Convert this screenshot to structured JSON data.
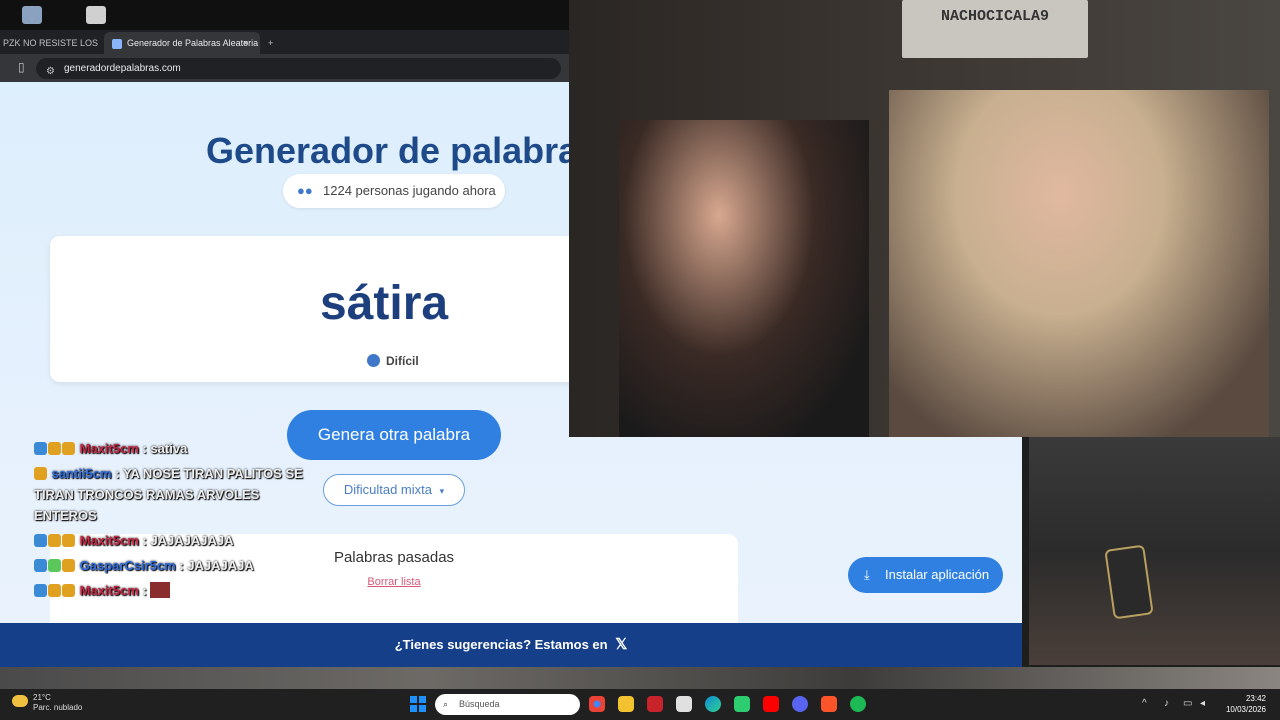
{
  "browser": {
    "tabs": [
      {
        "label": "PZK NO RESISTE LOS Cl",
        "active": false
      },
      {
        "label": "Generador de Palabras Aleatoria",
        "active": true
      }
    ],
    "url": "generadordepalabras.com"
  },
  "page": {
    "title": "Generador de palabras",
    "players": "1224 personas jugando ahora",
    "word": "sátira",
    "difficulty": "Difícil",
    "generate_label": "Genera otra palabra",
    "mode_label": "Dificultad mixta",
    "history_title": "Palabras pasadas",
    "clear_label": "Borrar lista",
    "install_label": "Instalar aplicación",
    "footer_text": "¿Tienes sugerencias? Estamos en"
  },
  "chat": [
    {
      "user": "Maxit5cm",
      "color": "#c62845",
      "text": ": sativa"
    },
    {
      "user": "santii5cm",
      "color": "#2f6ee0",
      "text": ": YA NOSE TIRAN PALITOS SE TIRAN TRONCOS RAMAS ARVOLES ENTEROS"
    },
    {
      "user": "Maxit5cm",
      "color": "#c62845",
      "text": ": JAJAJAJAJA"
    },
    {
      "user": "GasparCsir5cm",
      "color": "#2f6ee0",
      "text": ": JAJAJAJA"
    },
    {
      "user": "Maxit5cm",
      "color": "#c62845",
      "text": ":"
    }
  ],
  "webcam": {
    "wall_sign": "NACHOCICALA9"
  },
  "taskbar": {
    "temp": "21°C",
    "weather": "Parc. nublado",
    "search_placeholder": "Búsqueda",
    "time": "23:42",
    "date": "10/03/2026"
  }
}
